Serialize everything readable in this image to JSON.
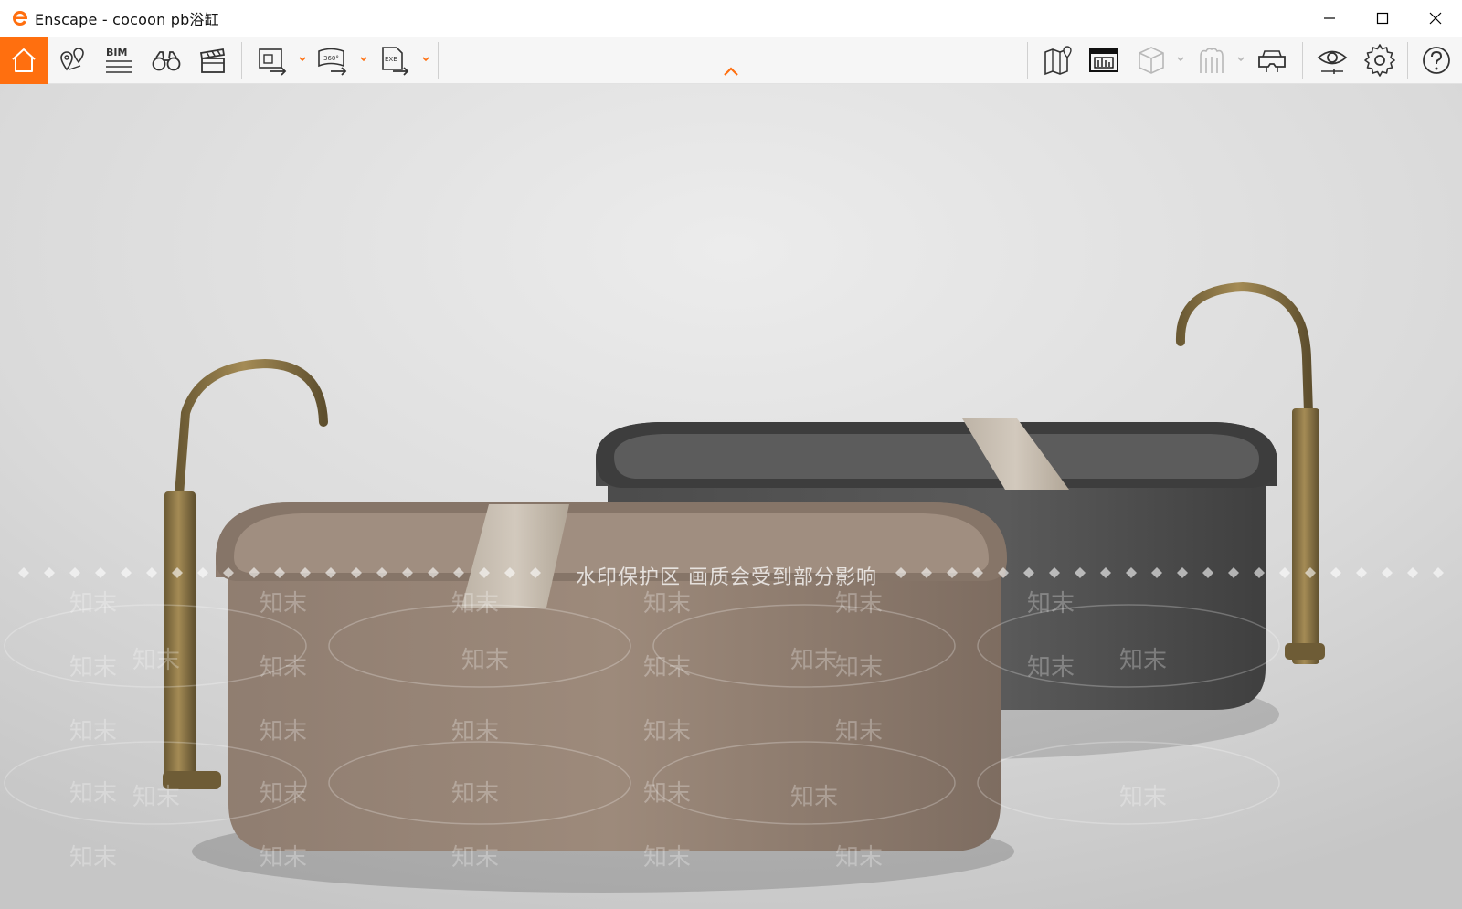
{
  "window": {
    "title": "Enscape - cocoon pb浴缸",
    "minimize_label": "",
    "maximize_label": "",
    "close_label": ""
  },
  "colors": {
    "accent": "#ff6f0f",
    "toolbar_bg": "#f6f6f6",
    "icon": "#333333",
    "icon_disabled": "#b8b8b8"
  },
  "toolbar": {
    "left_icons": [
      "home-icon",
      "views-icon",
      "bim-icon",
      "binoculars-icon",
      "clapper-icon",
      "export-image-icon",
      "export-360-icon",
      "export-exe-icon"
    ],
    "right_icons": [
      "map-icon",
      "screenshot-icon",
      "cube-icon",
      "asset-icon",
      "vr-headset-icon",
      "visual-settings-icon",
      "settings-icon",
      "help-icon"
    ],
    "bim_label": "BIM",
    "panorama_label": "360°",
    "exe_label": "EXE"
  },
  "viewport": {
    "watermark_text": "水印保护区   画质会受到部分影响",
    "watermark_tile": "知末"
  }
}
